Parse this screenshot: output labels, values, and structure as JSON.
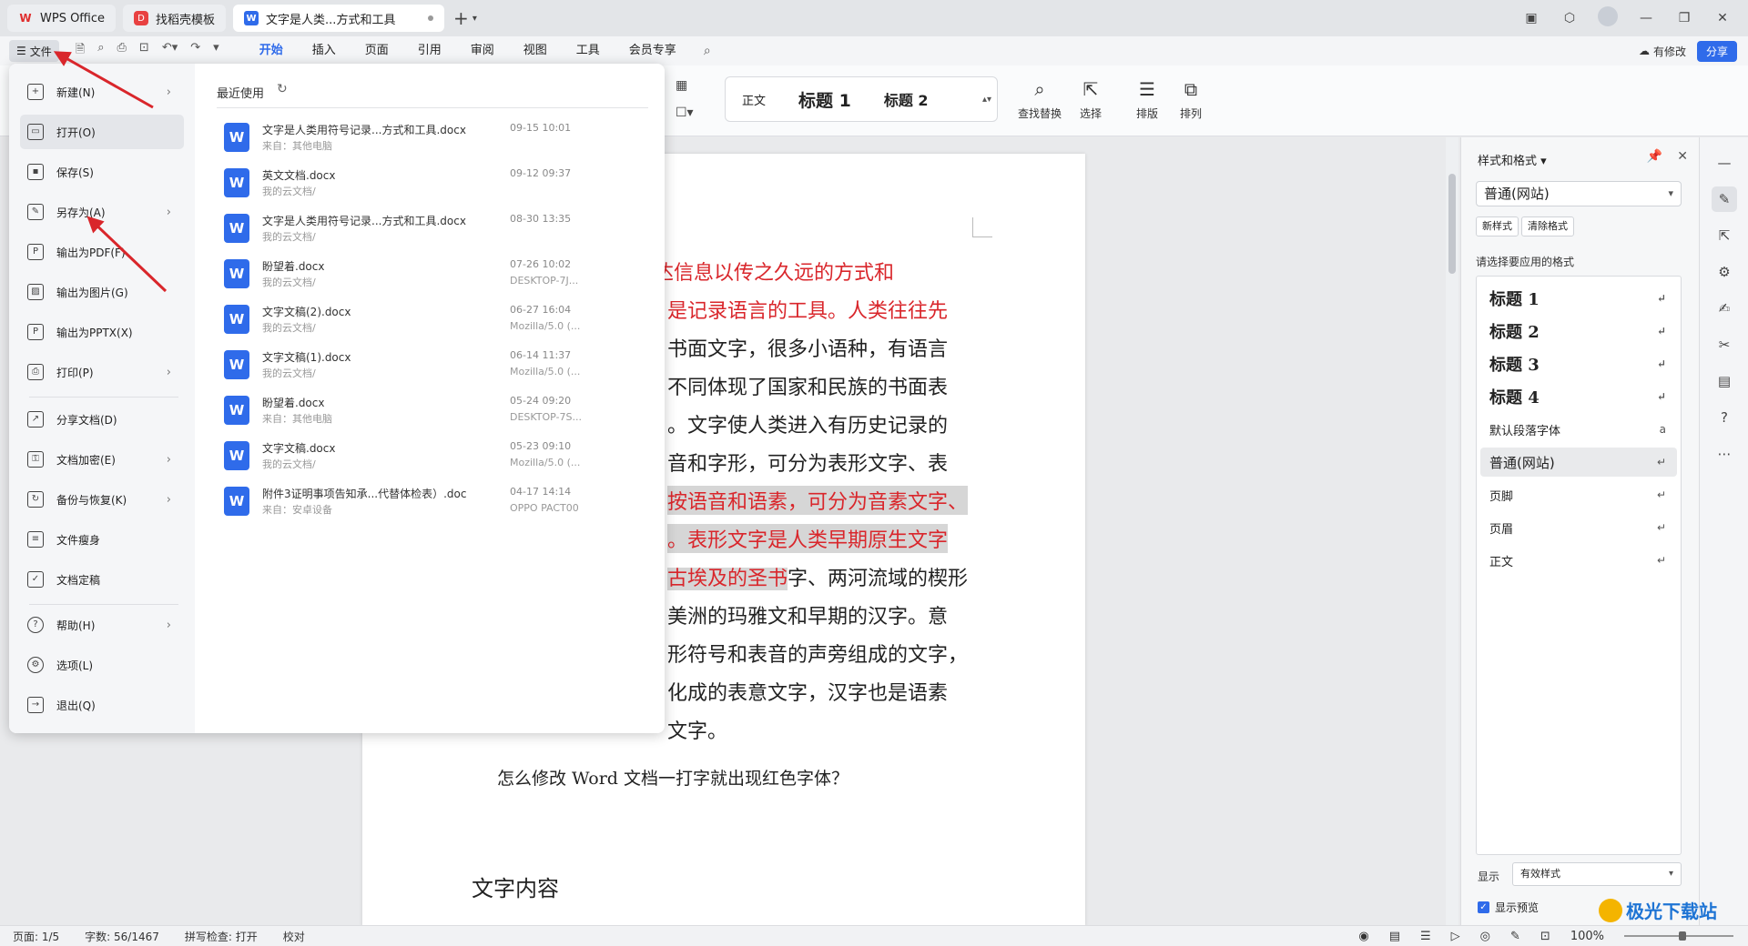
{
  "tabs": [
    {
      "label": "WPS Office"
    },
    {
      "label": "找稻壳模板"
    },
    {
      "label": "文字是人类...方式和工具"
    }
  ],
  "menu": {
    "file_label": "文件",
    "tabs": [
      "开始",
      "插入",
      "页面",
      "引用",
      "审阅",
      "视图",
      "工具",
      "会员专享"
    ],
    "modify_label": "有修改",
    "share_label": "分享"
  },
  "ribbon": {
    "styles": [
      "正文",
      "标题 1",
      "标题 2"
    ],
    "find_replace": "查找替换",
    "select": "选择",
    "typeset": "排版",
    "arrange": "排列"
  },
  "file_menu": {
    "items": [
      {
        "label": "新建(N)"
      },
      {
        "label": "打开(O)"
      },
      {
        "label": "保存(S)"
      },
      {
        "label": "另存为(A)"
      },
      {
        "label": "输出为PDF(F)"
      },
      {
        "label": "输出为图片(G)"
      },
      {
        "label": "输出为PPTX(X)"
      },
      {
        "label": "打印(P)"
      },
      {
        "label": "分享文档(D)"
      },
      {
        "label": "文档加密(E)"
      },
      {
        "label": "备份与恢复(K)"
      },
      {
        "label": "文件瘦身"
      },
      {
        "label": "文档定稿"
      },
      {
        "label": "帮助(H)"
      },
      {
        "label": "选项(L)"
      },
      {
        "label": "退出(Q)"
      }
    ],
    "recent_title": "最近使用",
    "recent": [
      {
        "name": "文字是人类用符号记录...方式和工具.docx",
        "source": "来自：其他电脑",
        "date": "09-15 10:01",
        "device": ""
      },
      {
        "name": "英文文档.docx",
        "source": "我的云文档/",
        "date": "09-12 09:37",
        "device": ""
      },
      {
        "name": "文字是人类用符号记录...方式和工具.docx",
        "source": "我的云文档/",
        "date": "08-30 13:35",
        "device": ""
      },
      {
        "name": "盼望着.docx",
        "source": "我的云文档/",
        "date": "07-26 10:02",
        "device": "DESKTOP-7J..."
      },
      {
        "name": "文字文稿(2).docx",
        "source": "我的云文档/",
        "date": "06-27 16:04",
        "device": "Mozilla/5.0 (..."
      },
      {
        "name": "文字文稿(1).docx",
        "source": "我的云文档/",
        "date": "06-14 11:37",
        "device": "Mozilla/5.0 (..."
      },
      {
        "name": "盼望着.docx",
        "source": "来自：其他电脑",
        "date": "05-24 09:20",
        "device": "DESKTOP-7S..."
      },
      {
        "name": "文字文稿.docx",
        "source": "我的云文档/",
        "date": "05-23 09:10",
        "device": "Mozilla/5.0 (..."
      },
      {
        "name": "附件3证明事项告知承...代替体检表）.doc",
        "source": "来自：安卓设备",
        "date": "04-17 14:14",
        "device": "OPPO PACT00"
      }
    ]
  },
  "document": {
    "lines": [
      "达信息以传之久远的方式和",
      "是记录语言的工具。人类往往先",
      "书面文字，很多小语种，有语言",
      "不同体现了国家和民族的书面表",
      "。文字使人类进入有历史记录的",
      "音和字形，可分为表形文字、表",
      "按语音和语素，可分为音素文字、",
      "。表形文字是人类早期原生文字",
      "古埃及的圣书字、两河流域的楔形",
      "美洲的玛雅文和早期的汉字。意",
      "形符号和表音的声旁组成的文字，",
      "化成的表意文字，汉字也是语素",
      "文字。"
    ],
    "question": "怎么修改 Word 文档一打字就出现红色字体？",
    "heading": "文字内容"
  },
  "style_panel": {
    "title": "样式和格式",
    "current": "普通(网站)",
    "new_style": "新样式",
    "clear_format": "清除格式",
    "prompt": "请选择要应用的格式",
    "items": [
      {
        "label": "标题 1"
      },
      {
        "label": "标题 2"
      },
      {
        "label": "标题 3"
      },
      {
        "label": "标题 4"
      },
      {
        "label": "默认段落字体"
      },
      {
        "label": "普通(网站)"
      },
      {
        "label": "页脚"
      },
      {
        "label": "页眉"
      },
      {
        "label": "正文"
      }
    ],
    "show_label": "显示",
    "show_value": "有效样式",
    "preview_label": "显示预览"
  },
  "status": {
    "page": "页面: 1/5",
    "words": "字数: 56/1467",
    "spell": "拼写检查: 打开",
    "proof": "校对",
    "zoom": "100%"
  },
  "watermark": "极光下载站",
  "colors": {
    "accent": "#2f6bea",
    "doc_red": "#d9262b",
    "arrow_red": "#d9262b"
  }
}
